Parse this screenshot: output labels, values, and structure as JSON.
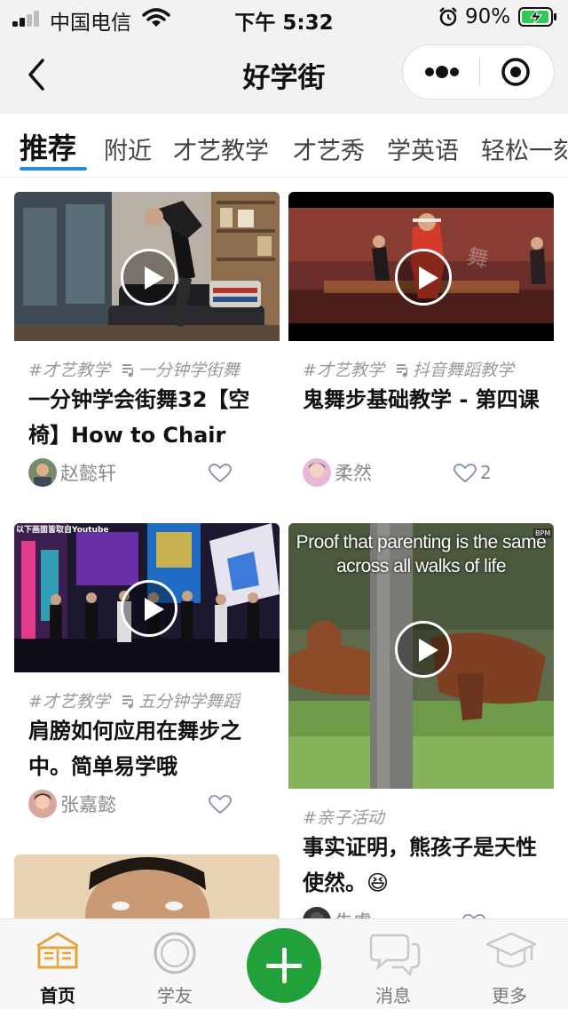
{
  "status_bar": {
    "carrier": "中国电信",
    "time": "下午 5:32",
    "battery": "90%"
  },
  "nav": {
    "title": "好学街"
  },
  "tabs": [
    {
      "label": "推荐",
      "active": true
    },
    {
      "label": "附近"
    },
    {
      "label": "才艺教学"
    },
    {
      "label": "才艺秀"
    },
    {
      "label": "学英语"
    },
    {
      "label": "轻松一刻"
    }
  ],
  "feed": [
    {
      "tag": "#才艺教学",
      "music": "一分钟学街舞",
      "title": "一分钟学会街舞32【空椅】How to Chair",
      "author": "赵懿轩",
      "likes": ""
    },
    {
      "tag": "#才艺教学",
      "music": "抖音舞蹈教学",
      "title": "鬼舞步基础教学 - 第四课",
      "author": "柔然",
      "likes": "2"
    },
    {
      "tag": "#才艺教学",
      "music": "五分钟学舞蹈",
      "title": "肩膀如何应用在舞步之中。简单易学哦",
      "author": "张嘉懿",
      "likes": "",
      "thumb_caption": "以下画面皆取自Youtube"
    },
    {
      "tag": "#亲子活动",
      "title": "事实证明，熊孩子是天性使然。😆",
      "author": "朱虞",
      "likes": "",
      "thumb_caption": "Proof that parenting is the same across all walks of life",
      "thumb_badge": "BPM"
    }
  ],
  "tabbar": {
    "home": "首页",
    "friends": "学友",
    "messages": "消息",
    "more": "更多"
  },
  "colors": {
    "accent_blue": "#2a8be0",
    "green_plus": "#22a13b",
    "home_active": "#e8a33a"
  }
}
